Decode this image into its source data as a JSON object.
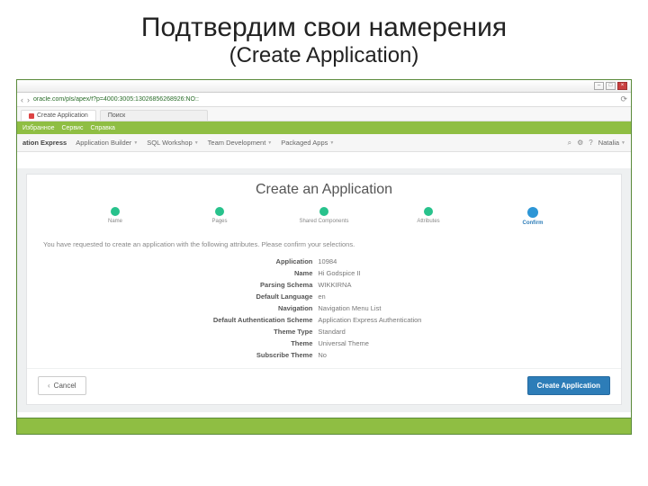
{
  "slide": {
    "title": "Подтвердим свои намерения",
    "subtitle": "(Create Application)"
  },
  "win": {
    "minimize": "–",
    "maximize": "□",
    "close": "×"
  },
  "addr": {
    "back": "‹",
    "fwd": "›",
    "url": "oracle.com/pls/apex/f?p=4000:3005:13026856268926:NO::"
  },
  "tab": {
    "label": "Create Application",
    "search_hint": "Поиск"
  },
  "fav": {
    "favorites": "Избранное",
    "services": "Сервис",
    "help": "Справка"
  },
  "nav": {
    "brand": "ation Express",
    "items": [
      "Application Builder",
      "SQL Workshop",
      "Team Development",
      "Packaged Apps"
    ],
    "user": "Natalia"
  },
  "bc": {
    "text": ""
  },
  "card": {
    "title": "Create an Application",
    "steps": [
      {
        "label": "Name"
      },
      {
        "label": "Pages"
      },
      {
        "label": "Shared Components"
      },
      {
        "label": "Attributes"
      },
      {
        "label": "Confirm",
        "active": true
      }
    ],
    "instruct": "You have requested to create an application with the following attributes. Please confirm your selections.",
    "attrs": [
      {
        "label": "Application",
        "value": "10984"
      },
      {
        "label": "Name",
        "value": "Hi Godspice II"
      },
      {
        "label": "Parsing Schema",
        "value": "WIKKIRNA"
      },
      {
        "label": "Default Language",
        "value": "en"
      },
      {
        "label": "Navigation",
        "value": "Navigation Menu List"
      },
      {
        "label": "Default Authentication Scheme",
        "value": "Application Express Authentication"
      },
      {
        "label": "Theme Type",
        "value": "Standard"
      },
      {
        "label": "Theme",
        "value": "Universal Theme"
      },
      {
        "label": "Subscribe Theme",
        "value": "No"
      }
    ],
    "cancel": "Cancel",
    "create": "Create Application"
  }
}
